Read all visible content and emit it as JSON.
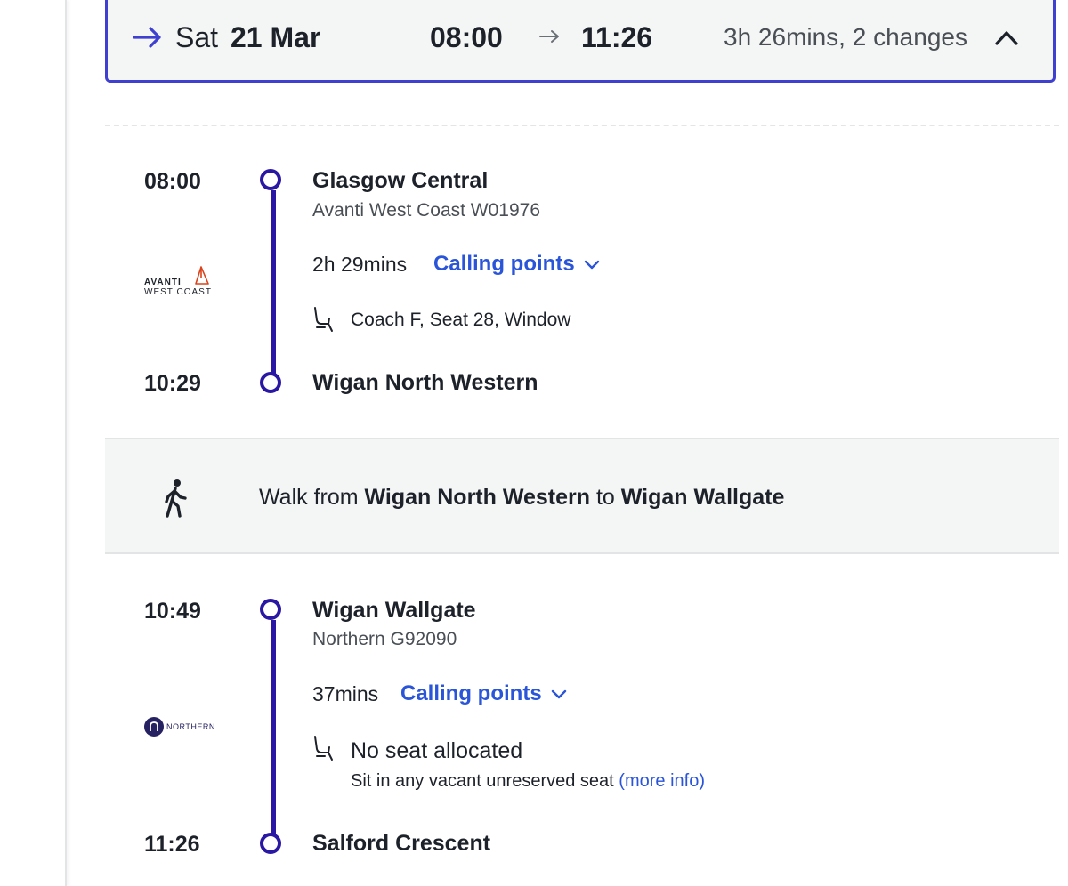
{
  "summary": {
    "day": "Sat",
    "date": "21 Mar",
    "depart": "08:00",
    "arrive": "11:26",
    "duration": "3h 26mins, 2 changes"
  },
  "legs": [
    {
      "depart_time": "08:00",
      "from": "Glasgow Central",
      "service": "Avanti West Coast W01976",
      "duration": "2h 29mins",
      "calling_points": "Calling points",
      "seat": "Coach F, Seat 28, Window",
      "arrive_time": "10:29",
      "to": "Wigan North Western",
      "operator_logo_line1": "AVANTI",
      "operator_logo_line2": "WEST COAST"
    },
    {
      "depart_time": "10:49",
      "from": "Wigan Wallgate",
      "service": "Northern G92090",
      "duration": "37mins",
      "calling_points": "Calling points",
      "seat": "No seat allocated",
      "seat_note": "Sit in any vacant unreserved seat",
      "more_info": "(more info)",
      "arrive_time": "11:26",
      "to": "Salford Crescent",
      "operator_logo": "NORTHERN"
    }
  ],
  "walk": {
    "prefix": "Walk from",
    "from": "Wigan North Western",
    "middle": "to",
    "to": "Wigan Wallgate"
  },
  "colors": {
    "route_line": "#2a17a3",
    "link": "#2b55d9",
    "summary_border": "#3f3fd0",
    "avanti_accent": "#d9441c"
  }
}
